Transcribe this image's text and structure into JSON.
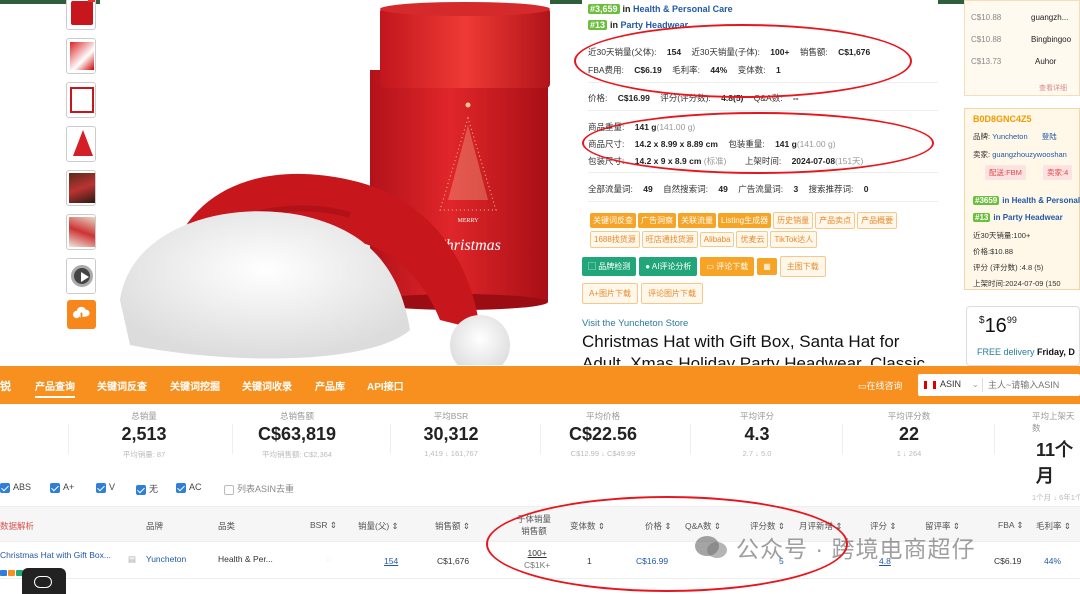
{
  "panel": {
    "rank1": {
      "num": "#3,659",
      "in": "in",
      "cat": "Health & Personal Care"
    },
    "rank2": {
      "num": "#13",
      "in": "in",
      "cat": "Party Headwear"
    },
    "row1": {
      "l1": "近30天销量(父体):",
      "v1": "154",
      "l2": "近30天销量(子体):",
      "v2": "100+",
      "l3": "销售额:",
      "v3": "C$1,676"
    },
    "row2": {
      "l1": "FBA费用:",
      "v1": "C$6.19",
      "l2": "毛利率:",
      "v2": "44%",
      "l3": "变体数:",
      "v3": "1"
    },
    "row3": {
      "l1": "价格:",
      "v1": "C$16.99",
      "l2": "评分(评分数):",
      "v2": "4.8(5)",
      "l3": "Q&A数:",
      "v3": "--"
    },
    "row4": {
      "l1": "商品重量:",
      "v1": "141 g",
      "v1b": "(141.00 g)"
    },
    "row5": {
      "l1": "商品尺寸:",
      "v1": "14.2 x 8.99 x 8.89 cm",
      "l2": "包装重量:",
      "v2": "141 g",
      "v2b": "(141.00 g)"
    },
    "row6": {
      "l1": "包装尺寸:",
      "v1": "14.2 x 9 x 8.9 cm",
      "v1b": "(标准)",
      "l2": "上架时间:",
      "v2": "2024-07-08",
      "v2b": "(151天)"
    },
    "row7": {
      "l1": "全部流量词:",
      "v1": "49",
      "l2": "自然搜索词:",
      "v2": "49",
      "l3": "广告流量词:",
      "v3": "3",
      "l4": "搜索推荐词:",
      "v4": "0"
    },
    "tags1": [
      "关键词反查",
      "广告洞察",
      "关联流量",
      "Listing生成器",
      "历史销量",
      "产品卖点",
      "产品概要"
    ],
    "tags2": [
      "1688找货源",
      "旺店通找货源",
      "Alibaba",
      "优麦云",
      "TikTok达人"
    ],
    "actions": {
      "brand": "品牌检测",
      "ai": "AI评论分析",
      "reviews": "评论下载",
      "calc_icon": "calculator-icon",
      "main_img": "主图下载",
      "aplus": "A+图片下载",
      "review_img": "评论图片下载"
    }
  },
  "product": {
    "store": "Visit the Yuncheton Store",
    "title": "Christmas Hat with Gift Box, Santa Hat for Adult, Xmas Holiday Party Headwear, Classic",
    "box_text_small": "MERRY",
    "box_text_big": "Christmas"
  },
  "right_col": {
    "sellers": [
      {
        "price": "C$10.88",
        "name": "guangzh..."
      },
      {
        "price": "C$10.88",
        "name": "Bingbingoo"
      },
      {
        "price": "C$13.73",
        "name": "Auhor"
      }
    ],
    "more": "查看详细",
    "card": {
      "asin": "B0D8GNC4Z5",
      "brand_label": "品牌:",
      "brand": "Yuncheton",
      "login": "登陆",
      "seller_label": "卖家:",
      "seller": "guangzhouzywooshan",
      "ship": "配送:FBM",
      "sellers_count": "卖家:4",
      "rank1_num": "#3659",
      "rank1_cat": "in Health & Personal",
      "rank2_num": "#13",
      "rank2_cat": "in Party Headwear",
      "sales": "近30天销量:100+",
      "price": "价格:$10.88",
      "rating": "评分 (评分数) :4.8   (5)",
      "listed": "上架时间:2024-07-09 (150"
    },
    "price_main": "16",
    "price_cents": "99",
    "price_cur": "$",
    "delivery_label": "FREE delivery",
    "delivery_day": "Friday, D"
  },
  "nav": {
    "logo": "锐",
    "items": [
      "产品查询",
      "关键词反查",
      "关键词挖掘",
      "关键词收录",
      "产品库",
      "API接口"
    ],
    "online": "在线咨询",
    "market": "ASIN",
    "placeholder": "主人~请输入ASIN"
  },
  "stats": [
    {
      "label": "总销量",
      "value": "2,513",
      "sub": "平均销量: 87"
    },
    {
      "label": "总销售额",
      "value": "C$63,819",
      "sub": "平均销售额: C$2,364"
    },
    {
      "label": "平均BSR",
      "value": "30,312",
      "sub": "1,419 ↓ 161,767"
    },
    {
      "label": "平均价格",
      "value": "C$22.56",
      "sub": "C$12.99 ↓ C$49.99"
    },
    {
      "label": "平均评分",
      "value": "4.3",
      "sub": "2.7 ↓ 5.0"
    },
    {
      "label": "平均评分数",
      "value": "22",
      "sub": "1 ↓ 264"
    },
    {
      "label": "平均上架天数",
      "value": "11个月",
      "sub": "1个月 ↓ 6年1个"
    }
  ],
  "filters": [
    {
      "label": "ABS",
      "checked": true
    },
    {
      "label": "A+",
      "checked": true
    },
    {
      "label": "V",
      "checked": true
    },
    {
      "label": "无",
      "checked": true
    },
    {
      "label": "AC",
      "checked": true
    },
    {
      "label": "列表ASIN去重",
      "checked": false
    }
  ],
  "table": {
    "headers": {
      "info": "数据解析",
      "brand": "品牌",
      "category": "品类",
      "bsr": "BSR",
      "sales_parent": "销量(父)",
      "revenue": "销售额",
      "child_sales_1": "子体销量",
      "child_sales_2": "销售额",
      "variants": "变体数",
      "price": "价格",
      "qa": "Q&A数",
      "reviews": "评分数",
      "monthly_new": "月评新增",
      "rating": "评分",
      "retention": "留评率",
      "fba": "FBA",
      "margin": "毛利率"
    },
    "row": {
      "title": "Christmas Hat with Gift Box...",
      "brand": "Yuncheton",
      "category": "Health & Per...",
      "sales_parent": "154",
      "revenue": "C$1,676",
      "child_sales": "100+",
      "child_revenue": "C$1K+",
      "variants": "1",
      "price": "C$16.99",
      "reviews": "5",
      "rating": "4.8",
      "fba": "C$6.19",
      "margin": "44%"
    }
  },
  "watermark": "公众号 · 跨境电商超仔",
  "colors": {
    "accent": "#f7901e",
    "link": "#2159a8",
    "annotation": "#e8161c",
    "green": "#21a67a"
  }
}
